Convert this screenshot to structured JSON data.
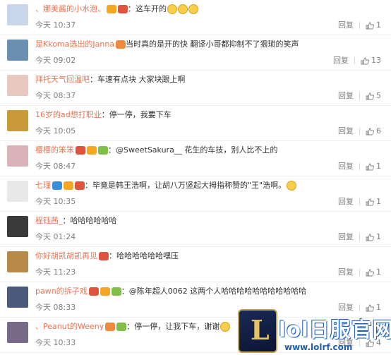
{
  "comments": [
    {
      "user": "、娜美酱的小水泡、",
      "text": "：这车开的",
      "time": "今天 10:37",
      "reply": "回复",
      "likes": "1",
      "avatar_color": "#c9d6ea",
      "badges": [
        "#f5a623",
        "#e0533c"
      ],
      "emoji_count": 3
    },
    {
      "user": "是Kkoma选出的Janna",
      "text": "当时真的是开的快 翻译小哥都抑制不了猥琐的笑声",
      "time": "今天 09:02",
      "reply": "回复",
      "likes": "13",
      "avatar_color": "#6b8fb0",
      "badges": [
        "#f08a3c"
      ],
      "emoji_count": 0
    },
    {
      "user": "拜托天气回温吧",
      "text": "：车速有点块 大家块跟上啊",
      "time": "今天 08:37",
      "reply": "回复",
      "likes": "5",
      "avatar_color": "#e8c9c0",
      "badges": [],
      "emoji_count": 0
    },
    {
      "user": "16岁的ad想打职业",
      "text": "：停一停，我要下车",
      "time": "今天 10:05",
      "reply": "回复",
      "likes": "6",
      "avatar_color": "#c99a3a",
      "badges": [],
      "emoji_count": 0
    },
    {
      "user": "樱樱的笨笨",
      "text": "：@SweetSakura__ 花生的车技，别人比不上的",
      "time": "今天 08:47",
      "reply": "回复",
      "likes": "1",
      "avatar_color": "#d9b3b8",
      "badges": [
        "#e0533c",
        "#f5a623",
        "#7fbf4a"
      ],
      "emoji_count": 0
    },
    {
      "user": "七瑾",
      "text": "：毕竟是韩王浩啊，让胡八万竖起大拇指称赞的\"王\"浩啊。",
      "time": "今天 10:35",
      "reply": "回复",
      "likes": "1",
      "avatar_color": "#e8e8e8",
      "badges": [
        "#3b8fd9",
        "#f5a623",
        "#e0533c"
      ],
      "emoji_count": 1
    },
    {
      "user": "程钰茜_",
      "text": "：哈哈哈哈哈哈",
      "time": "今天 01:24",
      "reply": "回复",
      "likes": "1",
      "avatar_color": "#3a3a3a",
      "badges": [],
      "emoji_count": 0
    },
    {
      "user": "你好胡凯胡凯再见",
      "text": "：哈哈哈哈哈哈嘿压",
      "time": "今天 11:23",
      "reply": "回复",
      "likes": "1",
      "avatar_color": "#b88a4a",
      "badges": [
        "#e0533c"
      ],
      "emoji_count": 0
    },
    {
      "user": "pawn的拆子戏",
      "text": "：@陈年超人0062 这两个人哈哈哈哈哈哈哈哈哈哈哈",
      "time": "今天 08:33",
      "reply": "回复",
      "likes": "1",
      "avatar_color": "#4a5a7a",
      "badges": [
        "#e0533c",
        "#f5a623",
        "#7fbf4a"
      ],
      "emoji_count": 0
    },
    {
      "user": "、Peanut的Weeny",
      "text": "：停一停，让我下车，谢谢",
      "time": "今天 10:33",
      "reply": "回复",
      "likes": "4",
      "avatar_color": "#7a6a8a",
      "badges": [
        "#f08a3c",
        "#7fbf4a"
      ],
      "emoji_count": 1
    }
  ],
  "watermark": {
    "logo_letter": "L",
    "title": "lol日服官网",
    "url": "www.lolrf.com"
  }
}
